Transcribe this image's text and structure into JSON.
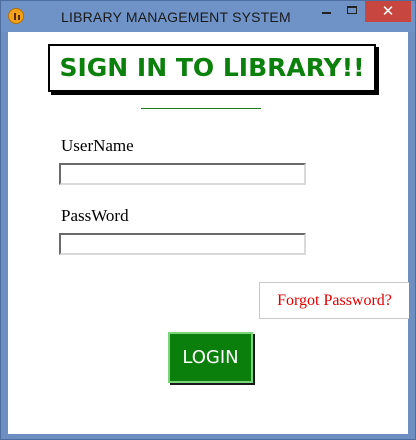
{
  "window": {
    "title": "LIBRARY MANAGEMENT SYSTEM",
    "app_icon": "library-app-icon",
    "controls": {
      "minimize": "minimize-icon",
      "maximize": "maximize-icon",
      "close": "✕"
    }
  },
  "form": {
    "heading": "SIGN IN TO LIBRARY!!",
    "username_label": "UserName",
    "username_value": "",
    "password_label": "PassWord",
    "password_value": "",
    "forgot_password": "Forgot Password?",
    "login_button": "LOGIN"
  },
  "colors": {
    "heading_text": "#0c800c",
    "login_bg": "#0b7f0b",
    "forgot_text": "#e00000",
    "close_bg": "#c7463f",
    "titlebar_bg": "#6f93c7"
  }
}
